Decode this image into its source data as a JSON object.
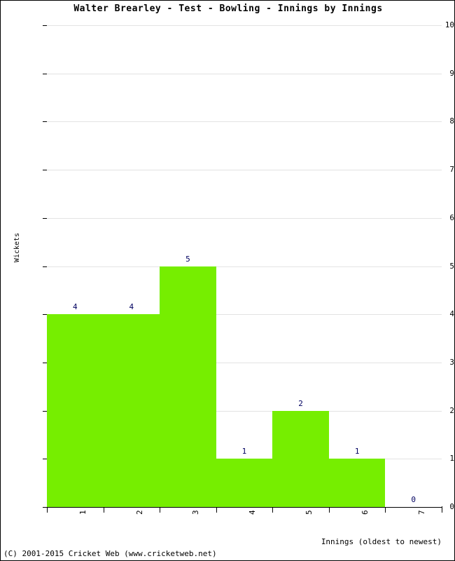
{
  "chart_data": {
    "type": "bar",
    "title": "Walter Brearley - Test - Bowling - Innings by Innings",
    "categories": [
      "1",
      "2",
      "3",
      "4",
      "5",
      "6",
      "7"
    ],
    "values": [
      4,
      4,
      5,
      1,
      2,
      1,
      0
    ],
    "xlabel": "Innings (oldest to newest)",
    "ylabel": "Wickets",
    "ylim": [
      0,
      10
    ],
    "yticks": [
      "0",
      "1",
      "2",
      "3",
      "4",
      "5",
      "6",
      "7",
      "8",
      "9",
      "10"
    ],
    "grid": true,
    "legend": null,
    "bar_color": "#76ee00",
    "label_color": "#000060",
    "grid_color": "#e3e3e3"
  },
  "footer": {
    "copyright": "(C) 2001-2015 Cricket Web (www.cricketweb.net)"
  }
}
